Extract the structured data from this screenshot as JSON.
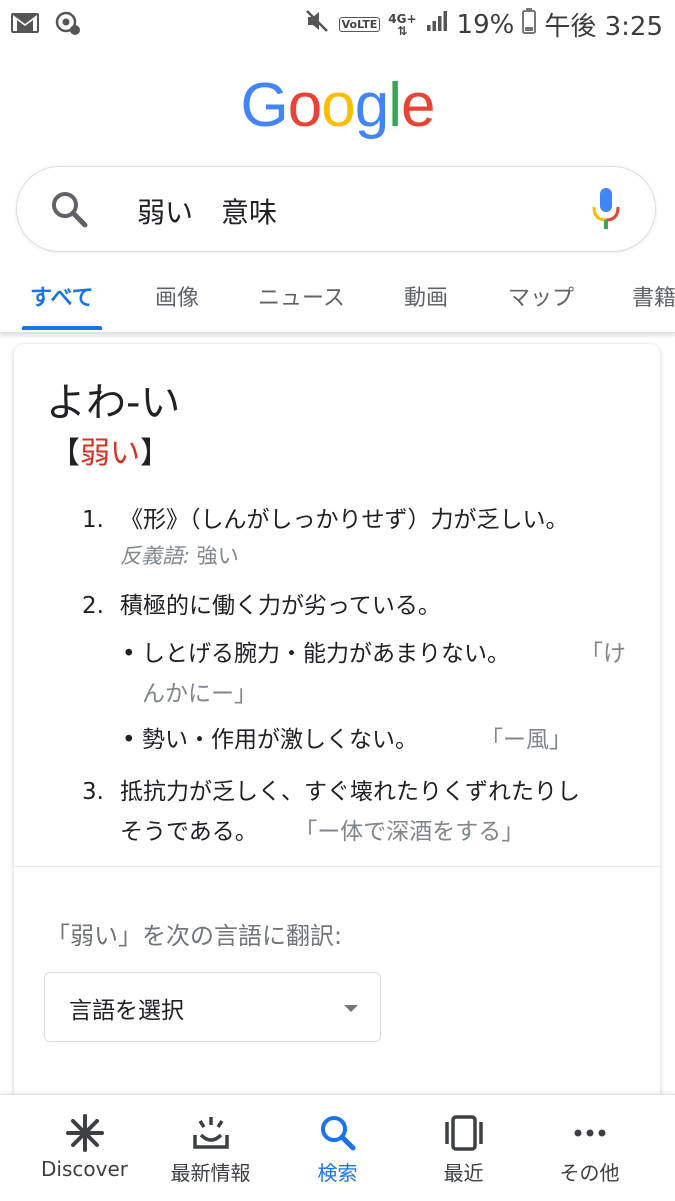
{
  "status_bar": {
    "battery": "19%",
    "time": "午後 3:25",
    "network": "4G+",
    "volte": "VoLTE"
  },
  "logo": [
    "G",
    "o",
    "o",
    "g",
    "l",
    "e"
  ],
  "logo_colors": [
    "#4285F4",
    "#EA4335",
    "#FBBC05",
    "#4285F4",
    "#34A853",
    "#EA4335"
  ],
  "search": {
    "query": "弱い　意味"
  },
  "tabs": [
    {
      "label": "すべて"
    },
    {
      "label": "画像"
    },
    {
      "label": "ニュース"
    },
    {
      "label": "動画"
    },
    {
      "label": "マップ"
    },
    {
      "label": "書籍"
    }
  ],
  "card": {
    "word": "よわ-い",
    "kanji_open": "【",
    "kanji": "弱い",
    "kanji_close": "】",
    "definitions": [
      {
        "num": "1.",
        "text": "《形》（しんがしっかりせず）力が乏しい。",
        "antonym_label": "反義語:",
        "antonym": "強い"
      },
      {
        "num": "2.",
        "text": "積極的に働く力が劣っている。",
        "subs": [
          {
            "line1": "しとげる腕力・能力があまりない。",
            "ex1": "「け",
            "line2": "んかにー」"
          },
          {
            "line1": "勢い・作用が激しくない。",
            "ex1": "「ー風」"
          }
        ]
      },
      {
        "num": "3.",
        "line1": "抵抗力が乏しく、すぐ壊れたりくずれたりし",
        "line2": "そうである。",
        "example": "「ー体で深酒をする」"
      }
    ],
    "translate_label": "「弱い」を次の言語に翻訳:",
    "select_label": "言語を選択"
  },
  "bottom_nav": [
    {
      "label": "Discover",
      "icon": "asterisk-icon"
    },
    {
      "label": "最新情報",
      "icon": "updates-icon"
    },
    {
      "label": "検索",
      "icon": "search-icon"
    },
    {
      "label": "最近",
      "icon": "recent-icon"
    },
    {
      "label": "その他",
      "icon": "more-icon"
    }
  ]
}
